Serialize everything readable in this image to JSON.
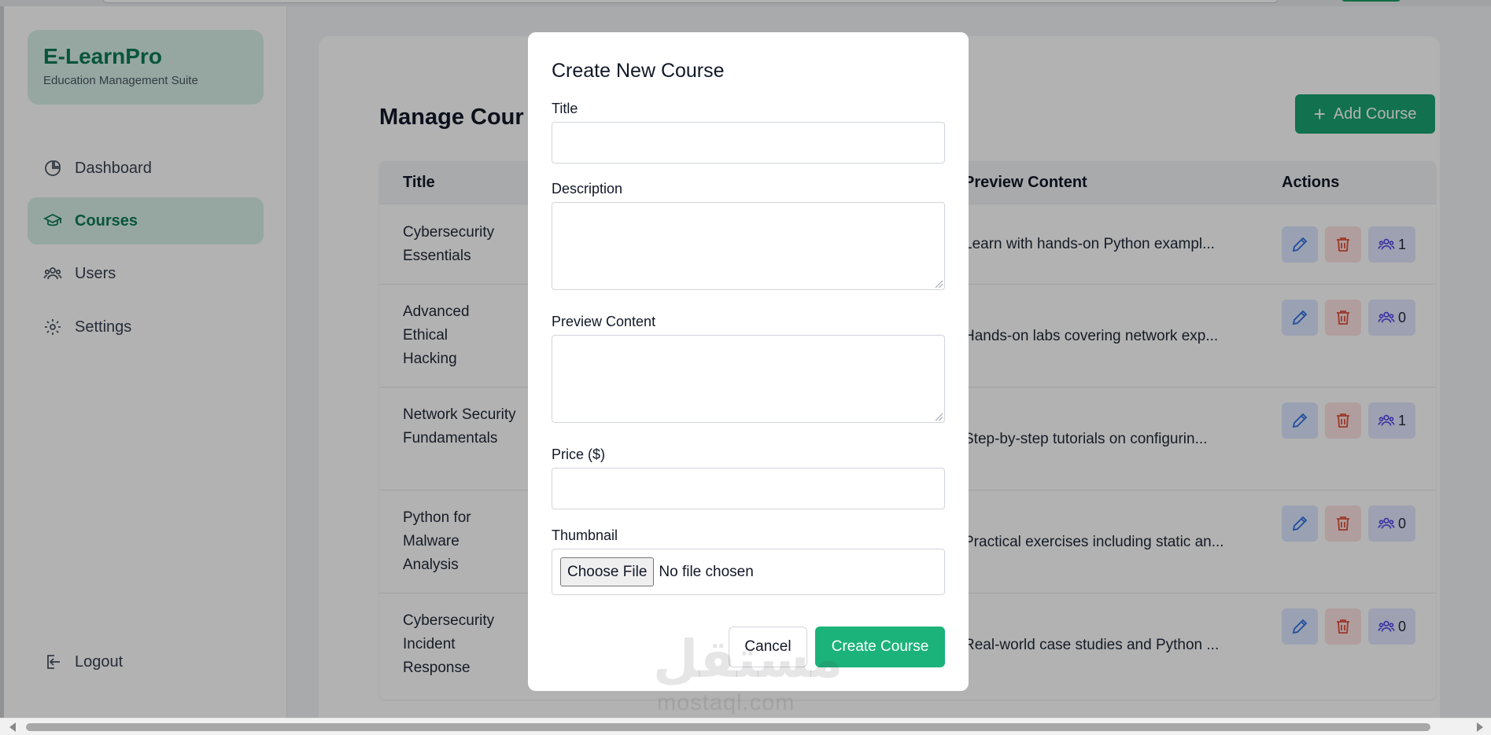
{
  "brand": {
    "title": "E-LearnPro",
    "subtitle": "Education Management Suite"
  },
  "sidebar": {
    "items": [
      {
        "label": "Dashboard",
        "icon": "pie-chart-icon"
      },
      {
        "label": "Courses",
        "icon": "graduation-cap-icon",
        "active": true
      },
      {
        "label": "Users",
        "icon": "users-icon"
      },
      {
        "label": "Settings",
        "icon": "gear-icon"
      }
    ],
    "logout": "Logout"
  },
  "main": {
    "title": "Manage Cour",
    "add_button": "Add Course",
    "table": {
      "headers": {
        "title": "Title",
        "preview": "Preview Content",
        "actions": "Actions"
      },
      "rows": [
        {
          "title": "Cybersecurity Essentials",
          "preview": "Learn with hands-on Python exampl...",
          "enrolled": "1"
        },
        {
          "title": "Advanced Ethical Hacking",
          "preview": "Hands-on labs covering network exp...",
          "enrolled": "0"
        },
        {
          "title": "Network Security Fundamentals",
          "preview": "Step-by-step tutorials on configurin...",
          "enrolled": "1"
        },
        {
          "title": "Python for Malware Analysis",
          "preview": "Practical exercises including static an...",
          "enrolled": "0"
        },
        {
          "title": "Cybersecurity Incident Response",
          "preview": "Real-world case studies and Python ...",
          "enrolled": "0"
        }
      ]
    }
  },
  "modal": {
    "heading": "Create New Course",
    "title_label": "Title",
    "description_label": "Description",
    "preview_label": "Preview Content",
    "price_label": "Price ($)",
    "thumbnail_label": "Thumbnail",
    "file_button": "Choose File",
    "file_status": "No file chosen",
    "cancel": "Cancel",
    "submit": "Create Course",
    "values": {
      "title": "",
      "description": "",
      "preview": "",
      "price": ""
    }
  },
  "watermark": {
    "main": "مستقل",
    "sub": "mostaql.com"
  },
  "colors": {
    "brand_green": "#0d7a55",
    "button_green": "#1aa371",
    "active_bg": "#d7f0e7",
    "edit_blue": "#2f6fe0",
    "delete_red": "#e0503b"
  }
}
